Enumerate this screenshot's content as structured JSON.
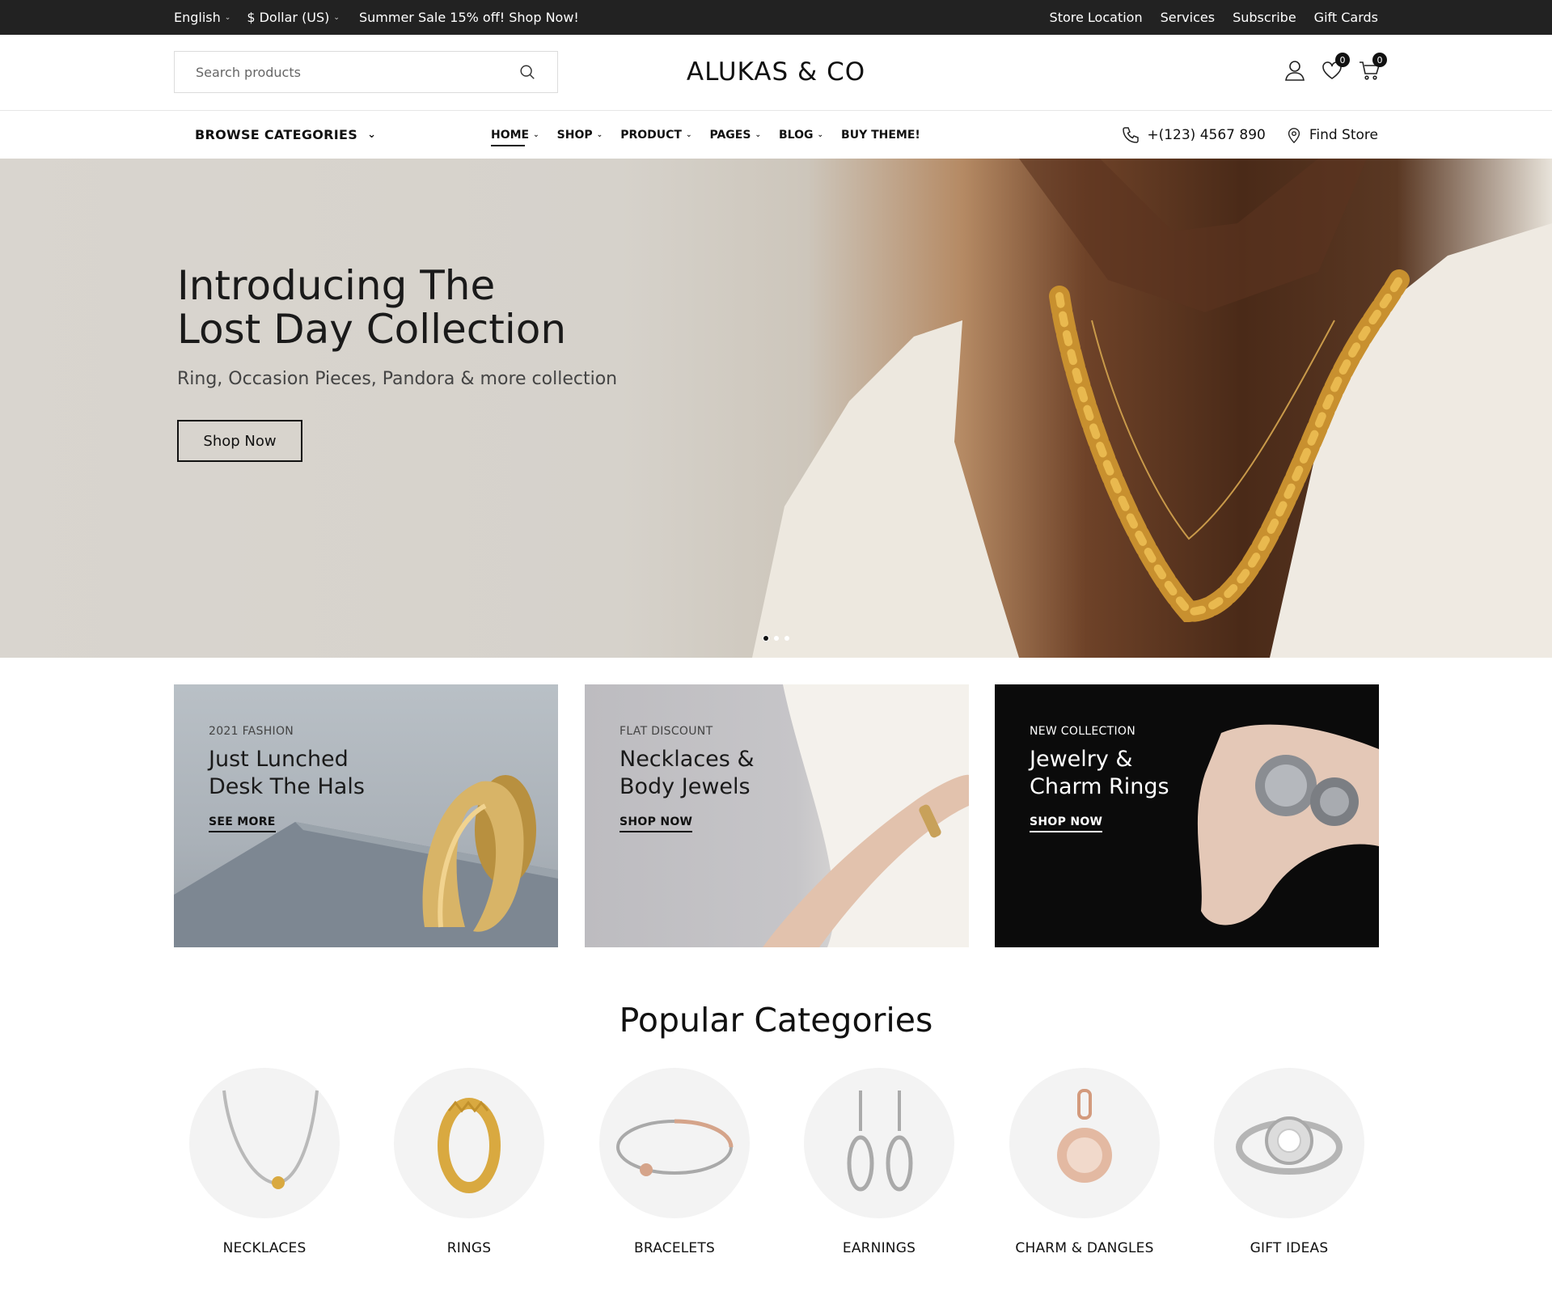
{
  "topbar": {
    "language": "English",
    "currency": "$ Dollar (US)",
    "promo": "Summer Sale 15% off! Shop Now!",
    "links": [
      "Store Location",
      "Services",
      "Subscribe",
      "Gift Cards"
    ]
  },
  "header": {
    "search_placeholder": "Search products",
    "logo": "ALUKAS & CO",
    "wishlist_count": "0",
    "cart_count": "0"
  },
  "nav": {
    "browse": "BROWSE CATEGORIES",
    "menu": [
      "HOME",
      "SHOP",
      "PRODUCT",
      "PAGES",
      "BLOG",
      "BUY THEME!"
    ],
    "phone": "+(123) 4567 890",
    "find_store": "Find Store"
  },
  "hero": {
    "title_line1": "Introducing The",
    "title_line2": "Lost Day Collection",
    "subtitle": "Ring, Occasion Pieces, Pandora & more collection",
    "button": "Shop Now"
  },
  "banners": [
    {
      "tag": "2021 FASHION",
      "line1": "Just Lunched",
      "line2": "Desk The Hals",
      "link": "SEE MORE"
    },
    {
      "tag": "FLAT DISCOUNT",
      "line1": "Necklaces &",
      "line2": "Body Jewels",
      "link": "SHOP NOW"
    },
    {
      "tag": "NEW COLLECTION",
      "line1": "Jewelry &",
      "line2": "Charm Rings",
      "link": "SHOP NOW"
    }
  ],
  "popular": {
    "title": "Popular Categories",
    "items": [
      "NECKLACES",
      "RINGS",
      "BRACELETS",
      "EARNINGS",
      "CHARM & DANGLES",
      "GIFT IDEAS"
    ]
  }
}
